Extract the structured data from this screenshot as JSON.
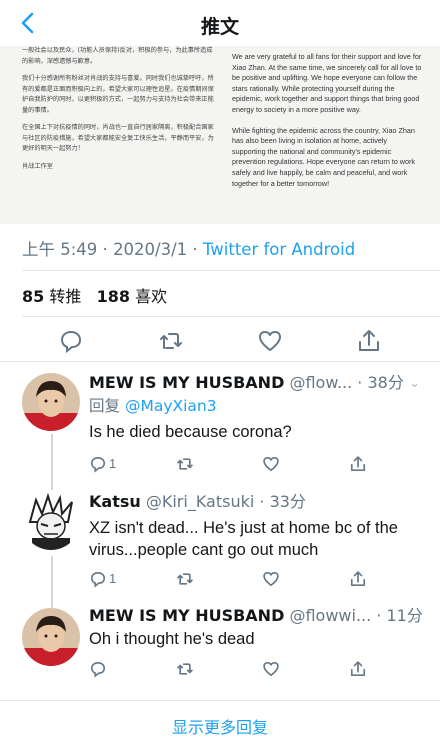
{
  "header": {
    "title": "推文"
  },
  "tweet": {
    "image_text_cn": [
      "一般社会以及民众，(功能人员保持)反对，积极的参与，为此事所造成的影响，深感遗憾与歉意。",
      "我们十分感谢所有粉丝对肖战的支持与喜爱。同时我们也诚挚呼吁，所有的爱都是正面而积极向上的，希望大家可以理性追星。在疫情期间保护自我防护的同时，以更积极的方式，一起努力与支持为社会带来正能量的事情。",
      "在全国上下对抗疫情的同时，肖战也一直自行居家隔离，积极配合国家与社区的防疫措施，希望大家都能安全复工快乐生活，平静而平安，为更好的明天一起努力！",
      "肖战工作室"
    ],
    "image_text_en": [
      "We are very grateful to all fans for their support and love for Xiao Zhan. At the same time, we sincerely call for all love to be positive and uplifting. We hope everyone can follow the stars rationally. While protecting yourself during the epidemic, work together and support things that bring good energy to society in a more positive way.",
      "While fighting the epidemic across the country, Xiao Zhan has also been living in isolation at home, actively supporting the national and community's epidemic prevention regulations. Hope everyone can return to work safely and live happily, be calm and peaceful, and work together for a better tomorrow!"
    ],
    "time": "上午 5:49",
    "dot": " · ",
    "date": "2020/3/1",
    "source": "Twitter for Android",
    "retweets_count": "85",
    "retweets_label": "转推",
    "likes_count": "188",
    "likes_label": "喜欢"
  },
  "replies": [
    {
      "name": "MEW IS MY HUSBAND",
      "handle": "@flow...",
      "time": "· 38分",
      "reply_to_label": "回复",
      "reply_to_handle": "@MayXian3",
      "text": "Is he died because corona?",
      "reply_count": "1"
    },
    {
      "name": "Katsu",
      "handle": "@Kiri_Katsuki",
      "time": "· 33分",
      "text": "XZ isn't dead... He's just at home bc of the virus...people cant go out much",
      "reply_count": "1"
    },
    {
      "name": "MEW IS MY HUSBAND",
      "handle": "@flowwi...",
      "time": "· 11分",
      "text": "Oh i thought he's dead"
    }
  ],
  "show_more": "显示更多回复"
}
